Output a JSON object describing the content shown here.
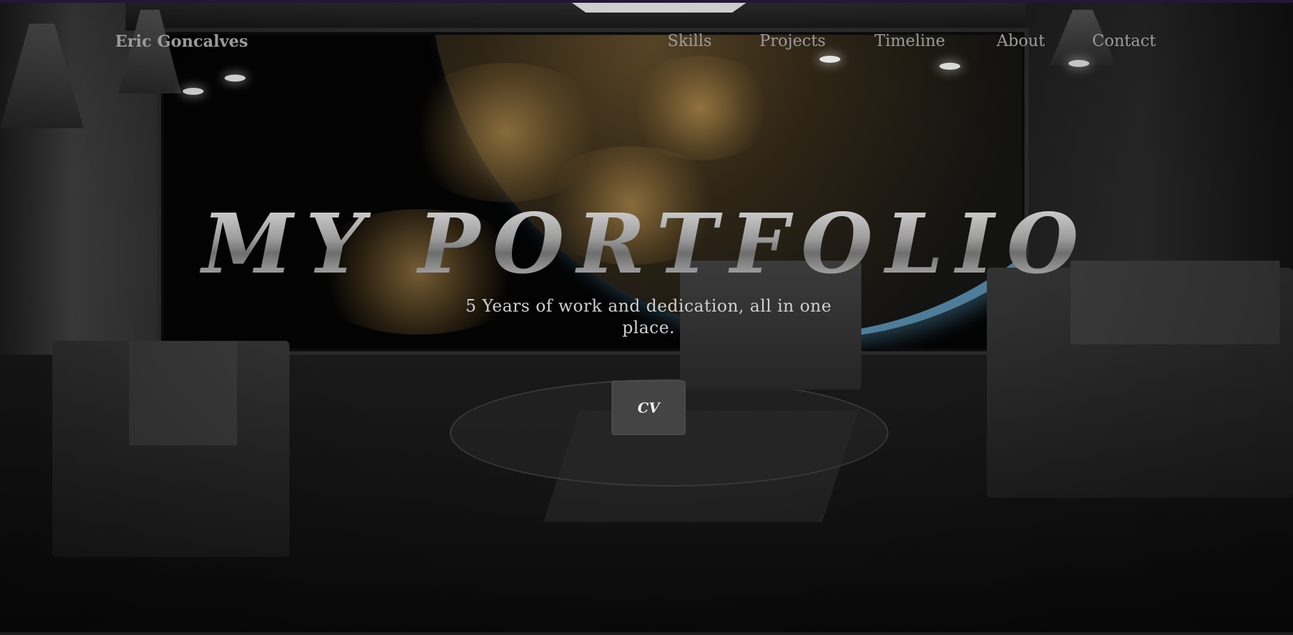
{
  "nav": {
    "brand": "Eric Goncalves",
    "links": [
      {
        "label": "Skills"
      },
      {
        "label": "Projects"
      },
      {
        "label": "Timeline"
      },
      {
        "label": "About"
      },
      {
        "label": "Contact"
      }
    ]
  },
  "hero": {
    "title": "MY PORTFOLIO",
    "subtitle": "5 Years of work and dedication, all in one place.",
    "cv_label": "CV"
  },
  "colors": {
    "nav_text": "#9b9b9b",
    "button_bg": "#444444",
    "top_strip": "#241636"
  }
}
